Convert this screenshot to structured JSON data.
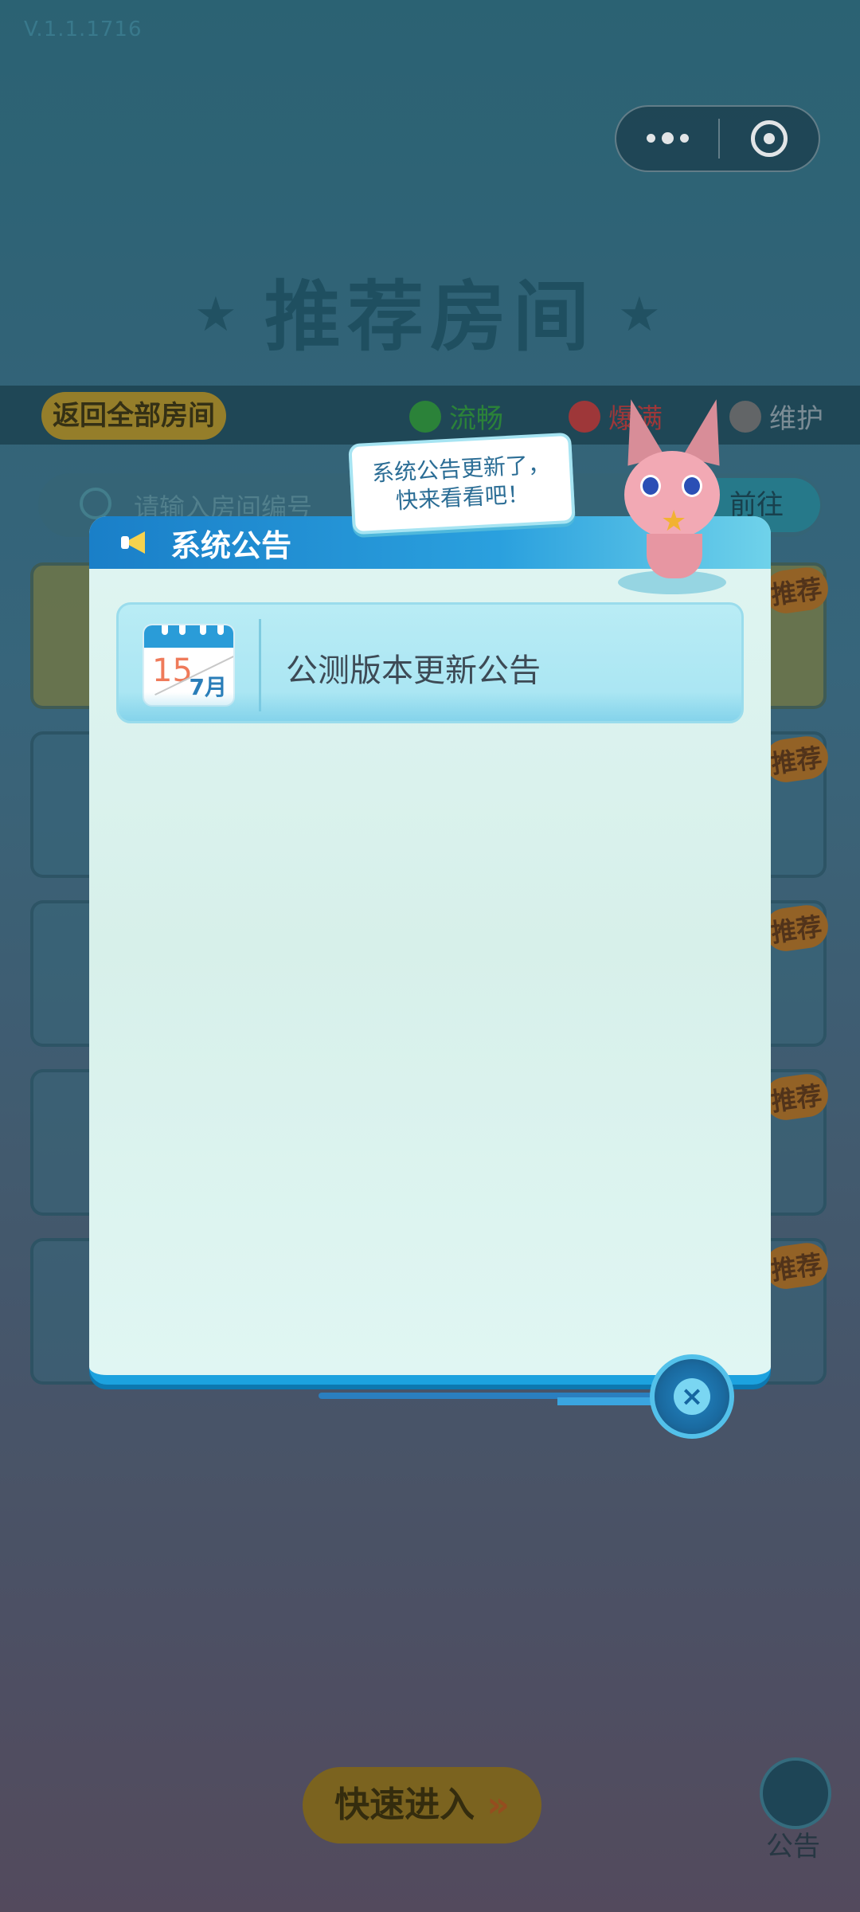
{
  "app": {
    "version": "V.1.1.1716",
    "page_title": "推荐房间"
  },
  "top_bar": {
    "back_all_rooms": "返回全部房间",
    "status_smooth": "流畅",
    "status_hot": "爆满",
    "status_maintenance": "维护"
  },
  "search": {
    "placeholder": "请输入房间编号",
    "go_label": "前往"
  },
  "room_list": {
    "badge": "推荐",
    "count": 5
  },
  "bottom": {
    "quick_enter": "快速进入",
    "notice_label": "公告"
  },
  "modal": {
    "title": "系统公告",
    "bubble_line1": "系统公告更新了，",
    "bubble_line2": "快来看看吧！",
    "items": [
      {
        "day": "15",
        "month": "7月",
        "title": "公测版本更新公告"
      }
    ]
  },
  "colors": {
    "header_blue": "#1a7fc8",
    "item_bg": "#b9ecf5",
    "status_green": "#2f8f3a",
    "status_red": "#b23a3a",
    "status_gray": "#6e6e6e",
    "quick_button": "#8a6c1c"
  },
  "icons": {
    "more": "more-dots-icon",
    "target": "target-circle-icon",
    "search": "search-icon",
    "megaphone": "megaphone-icon",
    "calendar": "calendar-icon",
    "close": "close-icon"
  }
}
